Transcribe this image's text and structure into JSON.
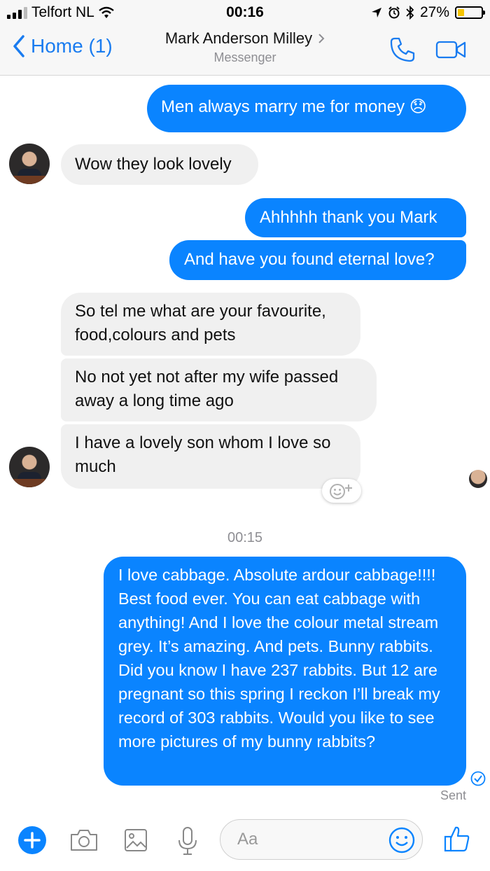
{
  "status_bar": {
    "carrier": "Telfort NL",
    "time": "00:16",
    "battery_percent": "27%",
    "battery_level": 0.27
  },
  "header": {
    "back_label": "Home (1)",
    "contact_name": "Mark Anderson Milley",
    "subtitle": "Messenger"
  },
  "messages": [
    {
      "direction": "outgoing",
      "text": "Men always marry me for money 😞"
    },
    {
      "direction": "incoming",
      "text": "Wow they look lovely"
    },
    {
      "direction": "outgoing",
      "text": "Ahhhhh thank you Mark"
    },
    {
      "direction": "outgoing",
      "text": "And have you found eternal love?"
    },
    {
      "direction": "incoming",
      "text": "So tel me what are your favourite, food,colours and  pets"
    },
    {
      "direction": "incoming",
      "text": "No not yet not after my wife passed away a long time ago"
    },
    {
      "direction": "incoming",
      "text": "I have a lovely son whom I love so much"
    },
    {
      "direction": "outgoing",
      "text": "I love cabbage. Absolute ardour cabbage!!!! Best food ever. You can eat cabbage with anything! And I love the colour metal stream grey. It’s amazing. And pets. Bunny rabbits. Did you know I have 237 rabbits. But 12 are pregnant so this spring I reckon I’ll break my record of 303 rabbits. Would you like to see more pictures of my bunny rabbits?"
    }
  ],
  "timestamp_divider": "00:15",
  "delivery_status": "Sent",
  "composer": {
    "placeholder": "Aa"
  },
  "icons": {
    "back": "chevron-left-icon",
    "call": "phone-icon",
    "video": "video-camera-icon",
    "add": "plus-icon",
    "camera": "camera-icon",
    "gallery": "image-icon",
    "mic": "microphone-icon",
    "emoji": "smiley-icon",
    "like": "thumbs-up-icon",
    "reaction": "add-reaction-icon"
  },
  "colors": {
    "accent": "#0a84ff",
    "outgoing_bubble": "#0a84ff",
    "incoming_bubble": "#f0f0f0",
    "battery_fill": "#f5c400"
  }
}
